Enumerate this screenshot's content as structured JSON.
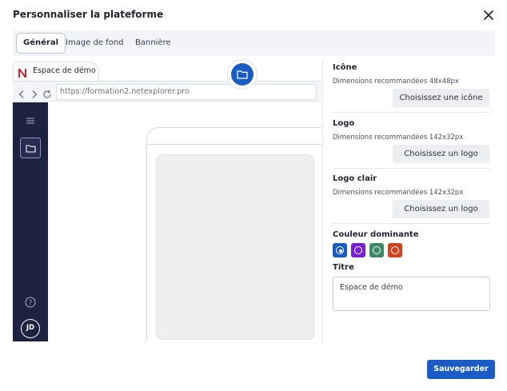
{
  "dialog": {
    "title": "Personnaliser la plateforme",
    "close_icon": "close-icon"
  },
  "tabs": [
    {
      "label": "Général",
      "active": true
    },
    {
      "label": "Image de fond",
      "active": false
    },
    {
      "label": "Bannière",
      "active": false
    }
  ],
  "preview": {
    "browser_tab_label": "Espace de démo",
    "url": "https://formation2.netexplorer.pro",
    "avatar_initials": "JD",
    "icons": [
      "netexplorer-logo-icon",
      "back-icon",
      "forward-icon",
      "reload-icon",
      "menu-icon",
      "folder-icon",
      "help-icon"
    ]
  },
  "settings": {
    "icon": {
      "title": "Icône",
      "hint": "Dimensions recommandées 48x48px",
      "button": "Choisissez une icône"
    },
    "logo": {
      "title": "Logo",
      "hint": "Dimensions recommandées 142x32px",
      "button": "Choisissez un logo"
    },
    "logo_light": {
      "title": "Logo clair",
      "hint": "Dimensions recommandées 142x32px",
      "button": "Choisissez un logo"
    },
    "dominant_color": {
      "title": "Couleur dominante",
      "options": [
        {
          "color": "#1b5cc4",
          "selected": true
        },
        {
          "color": "#7a1fd6",
          "selected": false
        },
        {
          "color": "#3e8a66",
          "selected": false
        },
        {
          "color": "#d1431d",
          "selected": false
        }
      ]
    },
    "title_field": {
      "label": "Titre",
      "value": "Espace de démo"
    }
  },
  "footer": {
    "save_label": "Sauvegarder"
  }
}
